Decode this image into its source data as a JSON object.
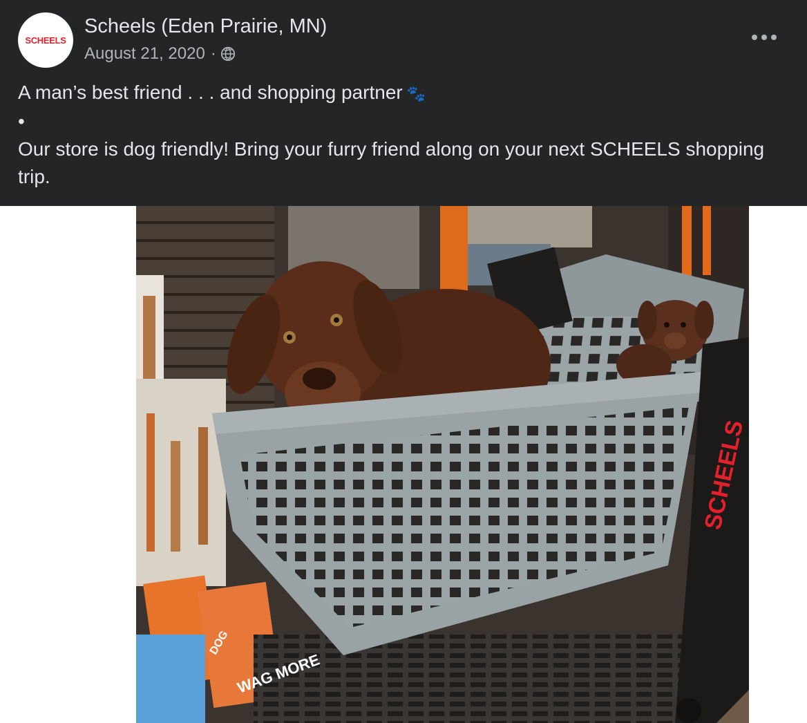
{
  "post": {
    "avatar_text": "SCHEELS",
    "page_name": "Scheels (Eden Prairie, MN)",
    "date": "August 21, 2020",
    "separator": "·",
    "privacy_icon": "globe-icon",
    "more_icon": "more-options-icon",
    "text": {
      "line1": "A man’s best friend . . . and shopping partner",
      "line1_emoji": "🐾",
      "line2": "•",
      "line3": "Our store is dog friendly! Bring your furry friend along on your next SCHEELS shopping trip."
    },
    "photo": {
      "cart_brand": "SCHEELS",
      "box_text_1": "WAG MORE",
      "box_text_2": "DOG"
    }
  },
  "colors": {
    "background": "#242526",
    "text": "#e4e6eb",
    "secondary_text": "#b0b3b8",
    "brand_red": "#e4202c"
  }
}
